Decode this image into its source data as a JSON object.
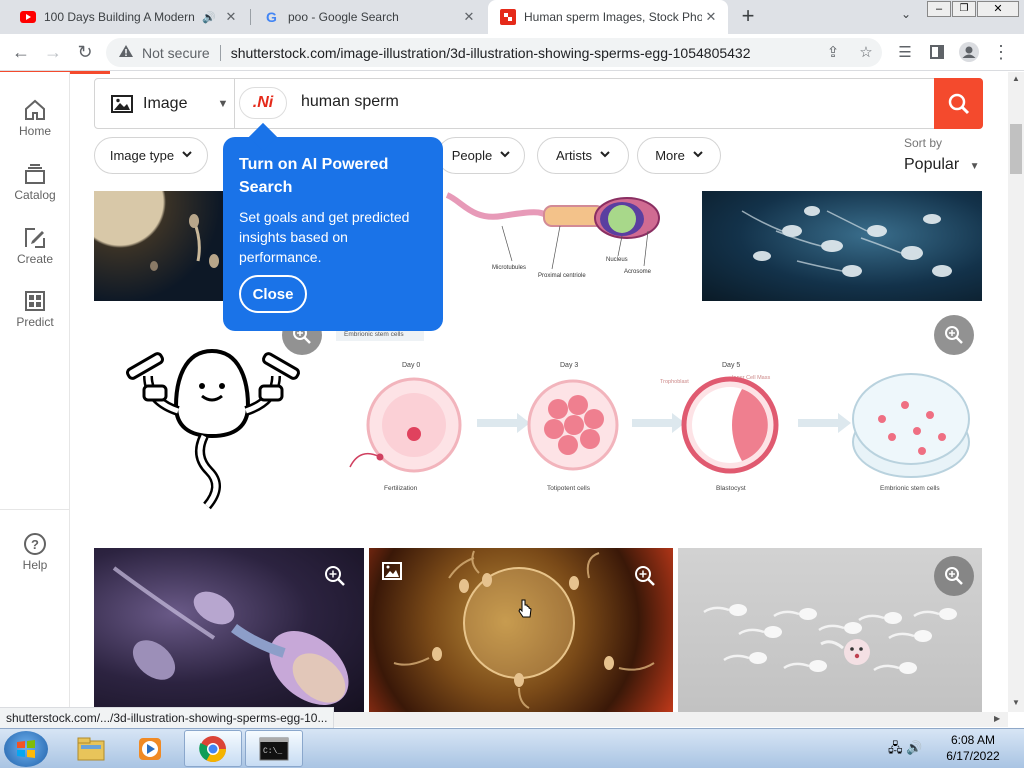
{
  "browser": {
    "tabs": [
      {
        "title": "100 Days Building A Modern",
        "icon": "youtube-icon",
        "audio": true
      },
      {
        "title": "poo - Google Search",
        "icon": "google-icon"
      },
      {
        "title": "Human sperm Images, Stock Pho",
        "icon": "shutterstock-icon",
        "active": true
      }
    ],
    "new_tab": "+",
    "security_label": "Not secure",
    "url": "shutterstock.com/image-illustration/3d-illustration-showing-sperms-egg-1054805432",
    "status_url": "shutterstock.com/.../3d-illustration-showing-sperms-egg-10..."
  },
  "sidebar": {
    "items": [
      {
        "label": "Home",
        "icon": "home-icon"
      },
      {
        "label": "Catalog",
        "icon": "catalog-icon"
      },
      {
        "label": "Create",
        "icon": "create-icon"
      },
      {
        "label": "Predict",
        "icon": "predict-icon"
      }
    ],
    "help_label": "Help"
  },
  "search": {
    "type_label": "Image",
    "ai_badge": ".Νi",
    "query": "human sperm"
  },
  "filters": {
    "image_type": "Image type",
    "people": "People",
    "artists": "Artists",
    "more": "More"
  },
  "sort": {
    "label": "Sort by",
    "value": "Popular"
  },
  "popover": {
    "title": "Turn on AI Powered Search",
    "body": "Set goals and get predicted insights based on performance.",
    "close": "Close"
  },
  "diagram_labels": {
    "microtubules": "Microtubules",
    "proximal_centriole": "Proximal centriole",
    "nucleus": "Nucleus",
    "acrosome": "Acrosome",
    "embryonic_header": "Embrionic stem cells",
    "day0": "Day 0",
    "day3": "Day 3",
    "day5": "Day 5",
    "fertilization": "Fertilization",
    "totipotent": "Totipotent cells",
    "blastocyst": "Blastocyst",
    "embryonic_cells": "Embrionic stem cells",
    "trophoblast": "Trophoblast",
    "inner_cell_mass": "Inner Cell Mass"
  },
  "taskbar": {
    "time": "6:08 AM",
    "date": "6/17/2022"
  },
  "colors": {
    "brand_red": "#f44a2d",
    "popover_blue": "#1a73e8"
  }
}
